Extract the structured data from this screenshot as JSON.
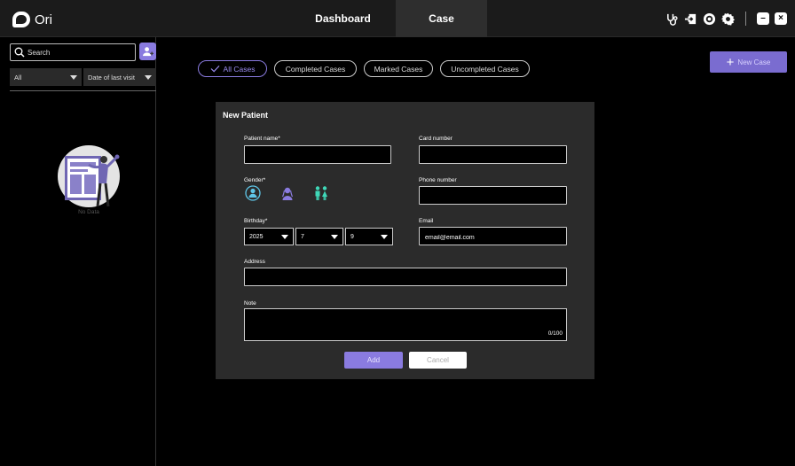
{
  "app": {
    "name": "Ori"
  },
  "topbar": {
    "tabs": [
      {
        "label": "Dashboard",
        "active": false
      },
      {
        "label": "Case",
        "active": true
      }
    ],
    "icons": [
      "stethoscope-icon",
      "import-icon",
      "record-icon",
      "settings-icon",
      "minimize-icon",
      "close-icon"
    ]
  },
  "sidebar": {
    "search_placeholder": "Search",
    "filter_type": "All",
    "filter_sort": "Date of last visit",
    "empty_text": "No Data"
  },
  "case_filters": [
    {
      "label": "All Cases",
      "active": true
    },
    {
      "label": "Completed Cases",
      "active": false
    },
    {
      "label": "Marked Cases",
      "active": false
    },
    {
      "label": "Uncompleted Cases",
      "active": false
    }
  ],
  "new_case_label": "New Case",
  "dialog": {
    "title": "New Patient",
    "patient_name_label": "Patient name*",
    "patient_name_value": "",
    "card_number_label": "Card number",
    "card_number_value": "",
    "gender_label": "Gender*",
    "gender_options": [
      "male-icon",
      "female-icon",
      "other-icon"
    ],
    "phone_label": "Phone number",
    "phone_value": "",
    "birthday_label": "Birthday*",
    "birthday_year": "2025",
    "birthday_month": "7",
    "birthday_day": "9",
    "email_label": "Email",
    "email_value": "email@email.com",
    "address_label": "Address",
    "address_value": "",
    "note_label": "Note",
    "note_value": "",
    "note_counter": "0/100",
    "add_label": "Add",
    "cancel_label": "Cancel"
  },
  "colors": {
    "accent": "#8a7be0",
    "gender_selected": "#5fc6e8",
    "gender_female": "#8a7be0",
    "gender_other": "#3fd8b8",
    "dialog_bg": "#2b2b2b"
  }
}
